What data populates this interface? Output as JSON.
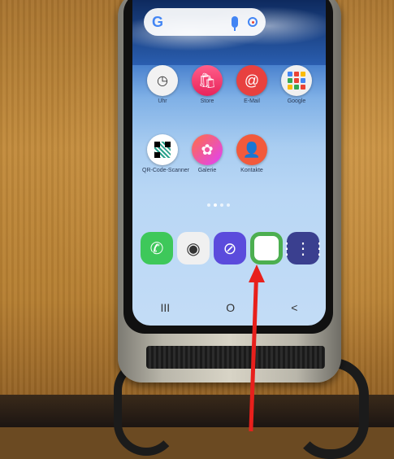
{
  "search": {
    "logo": "G"
  },
  "apps_row1": [
    {
      "label": "Uhr",
      "icon": "clock-icon",
      "glyph": "◷"
    },
    {
      "label": "Store",
      "icon": "shopping-bag-icon",
      "glyph": "🛍"
    },
    {
      "label": "E-Mail",
      "icon": "email-icon",
      "glyph": "@"
    },
    {
      "label": "Google",
      "icon": "google-folder-icon",
      "glyph": ""
    }
  ],
  "apps_row2": [
    {
      "label": "QR-Code-Scanner",
      "icon": "qr-code-icon",
      "glyph": ""
    },
    {
      "label": "Galerie",
      "icon": "gallery-icon",
      "glyph": "✿"
    },
    {
      "label": "Kontakte",
      "icon": "contacts-icon",
      "glyph": "👤"
    }
  ],
  "dock": [
    {
      "icon": "phone-icon",
      "glyph": "✆"
    },
    {
      "icon": "camera-icon",
      "glyph": "◉"
    },
    {
      "icon": "browser-icon",
      "glyph": "⊘"
    },
    {
      "icon": "bixby-ring-icon",
      "glyph": ""
    },
    {
      "icon": "app-drawer-icon",
      "glyph": "⋮⋮⋮"
    }
  ],
  "navbar": {
    "recent": "III",
    "home": "O",
    "back": "<"
  },
  "colors": {
    "arrow": "#e8201c"
  }
}
